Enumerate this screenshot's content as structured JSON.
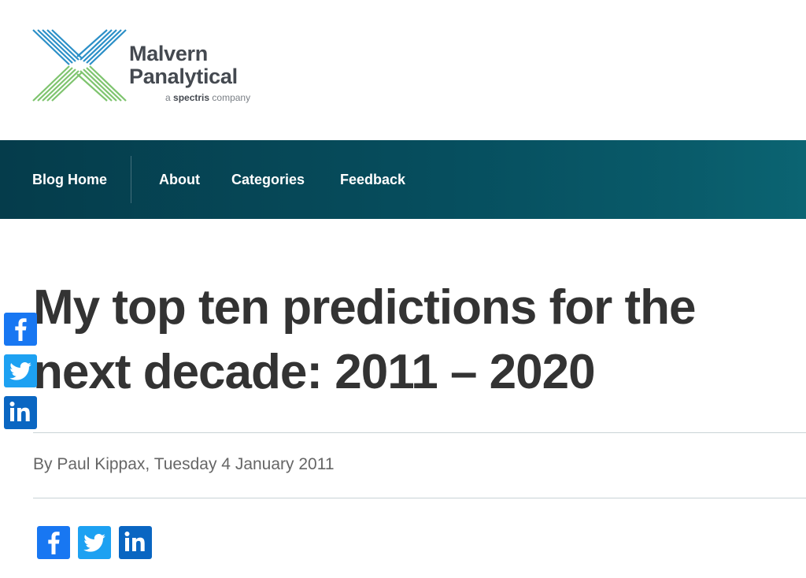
{
  "brand": {
    "logo_line1": "Malvern",
    "logo_line2": "Panalytical",
    "logo_sub_prefix": "a",
    "logo_sub_brand": "spectris",
    "logo_sub_suffix": "company",
    "colors": {
      "mark_blue": "#2b8fc7",
      "mark_green": "#7ec46e",
      "text": "#444950"
    }
  },
  "nav": {
    "items": [
      {
        "label": "Blog Home"
      },
      {
        "label": "About"
      },
      {
        "label": "Categories"
      },
      {
        "label": "Feedback"
      }
    ],
    "colors": {
      "start": "#053c4b",
      "end": "#0b6472"
    }
  },
  "article": {
    "title_line1": "My top ten predictions for the",
    "title_line2": "next decade: 2011 – 2020",
    "byline": "By Paul Kippax, Tuesday 4 January 2011"
  },
  "share": {
    "icons": [
      "facebook-icon",
      "twitter-icon",
      "linkedin-icon"
    ],
    "colors": {
      "facebook": "#1877f2",
      "twitter": "#1da1f2",
      "linkedin": "#0a66c2"
    }
  }
}
